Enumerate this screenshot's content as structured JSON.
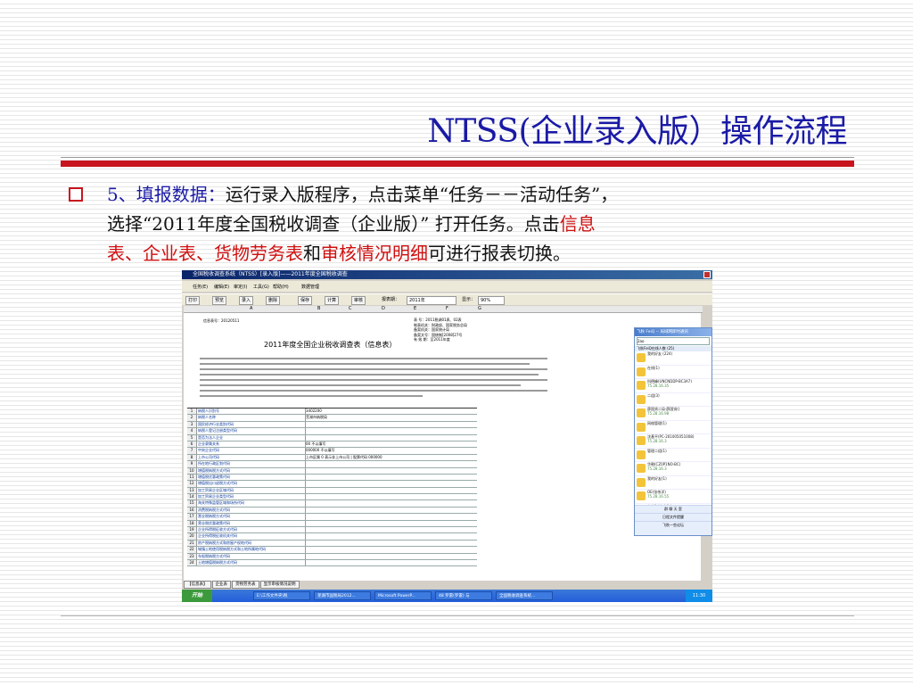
{
  "slide": {
    "title": "NTSS(企业录入版）操作流程",
    "step_label": "5、填报数据：",
    "text_1": "运行录入版程序，点击菜单“任务－－活动任务”，",
    "text_2": "选择“2011年度全国税收调查（企业版）” 打开任务。点击",
    "link_1": "信息",
    "link_2": "表、企业表、货物劳务表",
    "conj": "和",
    "link_3": "审核情况明细",
    "text_3": "可进行报表切换。"
  },
  "colors": {
    "title": "#1a1aa6",
    "accent_red": "#c8141e",
    "link_red": "#d01010"
  },
  "screenshot": {
    "window_title": "全国税收调查系统（NTSS）[录入版]——2011年度全国税收调查",
    "menu": [
      "任务(E)",
      "编辑(E)",
      "审定(I)",
      "工具(G)",
      "帮助(H)",
      "数据管理"
    ],
    "toolbar": [
      "打印",
      "预览",
      "录入",
      "删除",
      "保存",
      "计算",
      "审核",
      "报表期：",
      "2011年",
      "显示：",
      "90%"
    ],
    "columns": [
      "A",
      "B",
      "C",
      "D",
      "E",
      "F",
      "G"
    ],
    "sheet_title": "2011年度全国企业税收调查表（信息表）",
    "form_no": "信息表号：20120511",
    "meta": [
      "表    号：2011税调01表、02表",
      "制表机关：财政部、国家税务总局",
      "备案机关：国家统计局",
      "备案文号：国统制[2008]27号",
      "有 效 期：至2011年度"
    ],
    "rows": [
      {
        "n": "1",
        "label": "纳税人识别号",
        "value": "3402200"
      },
      {
        "n": "2",
        "label": "纳税人名称",
        "value": "芜湖市纳税局"
      },
      {
        "n": "3",
        "label": "国民经济行业类别代码",
        "value": ""
      },
      {
        "n": "4",
        "label": "纳税人登记注册类型代码",
        "value": ""
      },
      {
        "n": "5",
        "label": "是否为法人企业",
        "value": ""
      },
      {
        "n": "6",
        "label": "企业隶属关系",
        "value": "00 不以填写"
      },
      {
        "n": "7",
        "label": "中央企业代码",
        "value": "000000 不以填写"
      },
      {
        "n": "8",
        "label": "上市公司代码",
        "value": "上市区属 0 表示非上市公司 | 股票代码 000000"
      },
      {
        "n": "9",
        "label": "所在地行政区划代码",
        "value": ""
      },
      {
        "n": "10",
        "label": "增值税纳税方式代码",
        "value": ""
      },
      {
        "n": "11",
        "label": "增值税优惠政策代码",
        "value": ""
      },
      {
        "n": "12",
        "label": "增值税出口退税方式代码",
        "value": ""
      },
      {
        "n": "13",
        "label": "加工贸易企业区域代码",
        "value": ""
      },
      {
        "n": "14",
        "label": "加工贸易企业类型代码",
        "value": ""
      },
      {
        "n": "15",
        "label": "海关特殊监管区域和场所代码",
        "value": ""
      },
      {
        "n": "16",
        "label": "消费税纳税方式代码",
        "value": ""
      },
      {
        "n": "17",
        "label": "营业税纳税方式代码",
        "value": ""
      },
      {
        "n": "18",
        "label": "营业税优惠政策代码",
        "value": ""
      },
      {
        "n": "19",
        "label": "企业所得税征收方式代码",
        "value": ""
      },
      {
        "n": "20",
        "label": "企业所得税征收机关代码",
        "value": ""
      },
      {
        "n": "21",
        "label": "房产税纳税方式和房屋产权地代码",
        "value": ""
      },
      {
        "n": "22",
        "label": "城镇土地使用税纳税方式和土地所属地代码",
        "value": ""
      },
      {
        "n": "23",
        "label": "车船税纳税方式代码",
        "value": ""
      },
      {
        "n": "24",
        "label": "土地增值税纳税方式代码",
        "value": ""
      }
    ],
    "sheet_tabs": [
      "【信息表】",
      "企业表",
      "货物劳务表",
      "显示审核情况说明"
    ],
    "taskbar": {
      "start": "开始",
      "tasks": [
        "E:\\工作文件夹\\税",
        "芜湖市国税局2012...",
        "Microsoft PowerP...",
        "48 罗雷(罗雷) 与",
        "全国税收调查系统..."
      ],
      "clock": "11:30"
    },
    "qq": {
      "title": "飞秋 FeiQ -- 局域网即时通讯",
      "search": "2ao",
      "group": "飞秋FeiQ在线人数 (25)",
      "contacts": [
        {
          "name": "我的好友 (224)",
          "ip": ""
        },
        {
          "name": "在线(1)",
          "ip": ""
        },
        {
          "name": "科德峰(UNCNDDP-BC3A7)",
          "ip": "75.28.16.35"
        },
        {
          "name": "二组(3)",
          "ip": ""
        },
        {
          "name": "薛国贤二局·薛国贤()",
          "ip": "75.28.16.98"
        },
        {
          "name": "网络管理(1)",
          "ip": ""
        },
        {
          "name": "沈基平(PC-201005051008)",
          "ip": "75.28.16.3"
        },
        {
          "name": "管理二组(1)",
          "ip": ""
        },
        {
          "name": "华朝(CZ0P1NO-BC)",
          "ip": "75.28.16.3"
        },
        {
          "name": "我的好友(1)",
          "ip": ""
        },
        {
          "name": "OE(张伟洋)",
          "ip": "75.28.16.55"
        },
        {
          "name": "李大海(李大海)",
          "ip": "75.28.16.35"
        },
        {
          "name": "二组一科(2)",
          "ip": ""
        },
        {
          "name": "魏宏(魏宏)",
          "ip": "75.28.16.7"
        }
      ],
      "footer": [
        "群  聊  天  室",
        "日程文件提醒",
        "飞秋一些论坛"
      ]
    }
  }
}
